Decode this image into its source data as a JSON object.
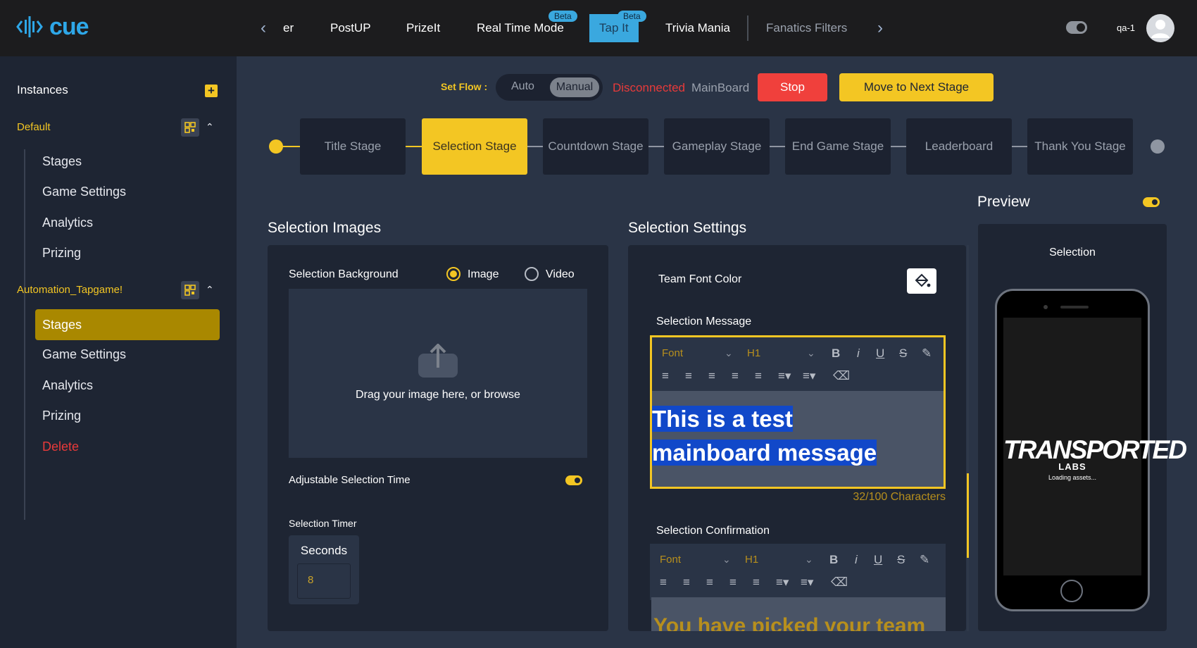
{
  "app": {
    "logo_text": "cue"
  },
  "topnav": {
    "items": [
      {
        "label": "er"
      },
      {
        "label": "PostUP"
      },
      {
        "label": "PrizeIt"
      },
      {
        "label": "Real Time Mode",
        "badge": "Beta"
      },
      {
        "label": "Tap It",
        "badge": "Beta",
        "active": true
      },
      {
        "label": "Trivia Mania"
      },
      {
        "label": "Fanatics Filters"
      }
    ],
    "user": "qa-1"
  },
  "sidebar": {
    "instances_label": "Instances",
    "groups": [
      {
        "name": "Default",
        "items": [
          "Stages",
          "Game Settings",
          "Analytics",
          "Prizing"
        ]
      },
      {
        "name": "Automation_Tapgame!",
        "items": [
          "Stages",
          "Game Settings",
          "Analytics",
          "Prizing",
          "Delete"
        ],
        "active_item": "Stages"
      }
    ]
  },
  "flow": {
    "set_flow_label": "Set Flow :",
    "auto_label": "Auto",
    "manual_label": "Manual",
    "status_disconnected": "Disconnected",
    "status_board": "MainBoard",
    "stop_label": "Stop",
    "next_label": "Move to Next Stage"
  },
  "stages": [
    "Title Stage",
    "Selection Stage",
    "Countdown Stage",
    "Gameplay Stage",
    "End Game Stage",
    "Leaderboard",
    "Thank You Stage"
  ],
  "selection_images": {
    "title": "Selection Images",
    "background_label": "Selection Background",
    "image_option": "Image",
    "video_option": "Video",
    "drop_text": "Drag your image here, or browse",
    "adjustable_label": "Adjustable Selection Time",
    "timer_label": "Selection Timer",
    "seconds_label": "Seconds",
    "seconds_value": "8"
  },
  "selection_settings": {
    "title": "Selection Settings",
    "team_font_color_label": "Team Font Color",
    "message_label": "Selection Message",
    "message_text": "This is a test mainboard message",
    "char_count": "32/100 Characters",
    "confirmation_label": "Selection Confirmation",
    "confirmation_text": "You have picked your team",
    "toolbar": {
      "font": "Font",
      "heading": "H1"
    }
  },
  "preview": {
    "title": "Preview",
    "screen_title": "Selection",
    "brand": "TRANSPORTED",
    "brand_sub": "LABS",
    "loading_text": "Loading assets..."
  },
  "colors": {
    "accent": "#f3c623",
    "brand_blue": "#2ea7e8",
    "danger": "#e83a3a",
    "selection": "#1148c9"
  }
}
